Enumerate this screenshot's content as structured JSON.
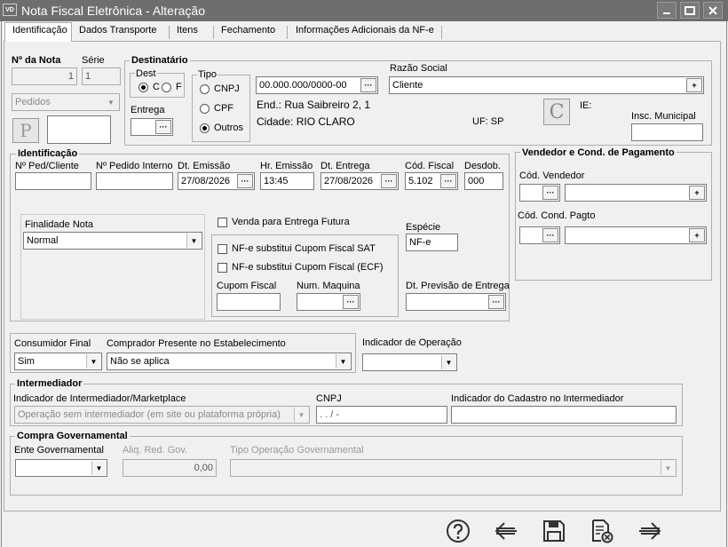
{
  "window": {
    "app_icon": "VD",
    "title": "Nota Fiscal Eletrônica - Alteração"
  },
  "tabs": [
    "Identificação",
    "Dados Transporte",
    "Itens",
    "Fechamento",
    "Informações Adicionais da NF-e"
  ],
  "nota": {
    "label": "Nº da Nota",
    "value": "1",
    "serie_label": "Série",
    "serie_value": "1",
    "pedidos": "Pedidos",
    "p_button": "P"
  },
  "destinatario": {
    "title": "Destinatário",
    "dest_label": "Dest",
    "dest_c": "C",
    "dest_f": "F",
    "entrega_label": "Entrega",
    "tipo_label": "Tipo",
    "tipo_cnpj": "CNPJ",
    "tipo_cpf": "CPF",
    "tipo_outros": "Outros",
    "cnpj_value": "00.000.000/0000-00",
    "razao_label": "Razão Social",
    "razao_value": "Cliente",
    "end": "End.: Rua Saibreiro 2, 1",
    "cidade": "Cidade: RIO CLARO",
    "uf": "UF: SP",
    "c_button": "C",
    "ie_label": "IE:",
    "insc_label": "Insc. Municipal"
  },
  "identificacao": {
    "title": "Identificação",
    "ped_cliente_label": "Nº Ped/Cliente",
    "ped_interno_label": "Nº Pedido Interno",
    "dt_emissao_label": "Dt. Emissão",
    "dt_emissao": "27/08/2026",
    "hr_emissao_label": "Hr. Emissão",
    "hr_emissao": "13:45",
    "dt_entrega_label": "Dt. Entrega",
    "dt_entrega": "27/08/2026",
    "cod_fiscal_label": "Cód. Fiscal",
    "cod_fiscal": "5.102",
    "desdob_label": "Desdob.",
    "desdob": "000",
    "finalidade_label": "Finalidade Nota",
    "finalidade": "Normal",
    "venda_futura": "Venda para Entrega Futura",
    "especie_label": "Espécie",
    "especie": "NF-e",
    "sat": "NF-e substitui Cupom Fiscal SAT",
    "ecf": "NF-e substitui Cupom Fiscal (ECF)",
    "cupom_label": "Cupom Fiscal",
    "maquina_label": "Num. Maquina",
    "previsao_label": "Dt. Previsão de Entrega"
  },
  "vendedor": {
    "title": "Vendedor e Cond. de Pagamento",
    "vendedor_label": "Cód. Vendedor",
    "cond_label": "Cód. Cond. Pagto"
  },
  "consumidor": {
    "consumidor_label": "Consumidor Final",
    "consumidor": "Sim",
    "comprador_label": "Comprador Presente no Estabelecimento",
    "comprador": "Não se aplica",
    "indicador_label": "Indicador de Operação"
  },
  "intermediador": {
    "title": "Intermediador",
    "indicador_label": "Indicador de Intermediador/Marketplace",
    "indicador": "Operação sem intermediador (em site ou plataforma própria)",
    "cnpj_label": "CNPJ",
    "cnpj": " .  .  /  -",
    "cadastro_label": "Indicador do Cadastro no Intermediador"
  },
  "compra_gov": {
    "title": "Compra Governamental",
    "ente_label": "Ente Governamental",
    "aliq_label": "Aliq. Red. Gov.",
    "aliq": "0,00",
    "tipo_label": "Tipo Operação Governamental"
  }
}
